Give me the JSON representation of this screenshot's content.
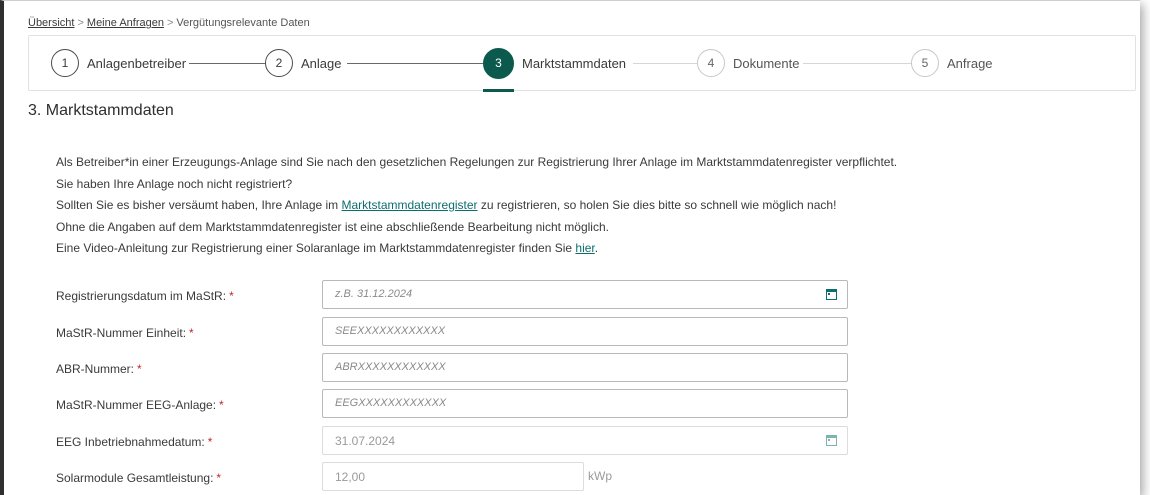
{
  "breadcrumb": {
    "items": [
      "Übersicht",
      "Meine Anfragen"
    ],
    "current": "Vergütungsrelevante Daten",
    "separator": ">"
  },
  "stepper": {
    "steps": [
      {
        "number": "1",
        "label": "Anlagenbetreiber"
      },
      {
        "number": "2",
        "label": "Anlage"
      },
      {
        "number": "3",
        "label": "Marktstammdaten"
      },
      {
        "number": "4",
        "label": "Dokumente"
      },
      {
        "number": "5",
        "label": "Anfrage"
      }
    ],
    "active_step": 3,
    "accent": "#0c5a4d"
  },
  "section_title": "3. Marktstammdaten",
  "intro": {
    "line1": "Als Betreiber*in einer Erzeugungs-Anlage sind Sie nach den gesetzlichen Regelungen zur Registrierung Ihrer Anlage im Marktstammdatenregister verpflichtet.",
    "line2": "Sie haben Ihre Anlage noch nicht registriert?",
    "line3_pre": "Sollten Sie es bisher versäumt haben, Ihre Anlage im ",
    "line3_link": "Marktstammdatenregister",
    "line3_post": " zu registrieren, so holen Sie dies bitte so schnell wie möglich nach!",
    "line4": "Ohne die Angaben auf dem Marktstammdatenregister ist eine abschließende Bearbeitung nicht möglich.",
    "line5_pre": "Eine Video-Anleitung zur Registrierung einer Solaranlage im Marktstammdatenregister finden Sie ",
    "line5_link": "hier",
    "line5_post": "."
  },
  "form": {
    "required_marker": "*",
    "fields": [
      {
        "label": "Registrierungsdatum im MaStR:",
        "placeholder": "z.B. 31.12.2024",
        "value": "",
        "icon": "calendar-icon"
      },
      {
        "label": "MaStR-Nummer Einheit:",
        "placeholder": "SEEXXXXXXXXXXXX",
        "value": ""
      },
      {
        "label": "ABR-Nummer:",
        "placeholder": "ABRXXXXXXXXXXXX",
        "value": ""
      },
      {
        "label": "MaStR-Nummer EEG-Anlage:",
        "placeholder": "EEGXXXXXXXXXXXX",
        "value": ""
      },
      {
        "label": "EEG Inbetriebnahmedatum:",
        "placeholder": "",
        "value": "31.07.2024",
        "icon": "calendar-icon",
        "disabled": true
      },
      {
        "label": "Solarmodule Gesamtleistung:",
        "placeholder": "",
        "value": "12,00",
        "unit": "kWp",
        "disabled": true
      }
    ]
  }
}
